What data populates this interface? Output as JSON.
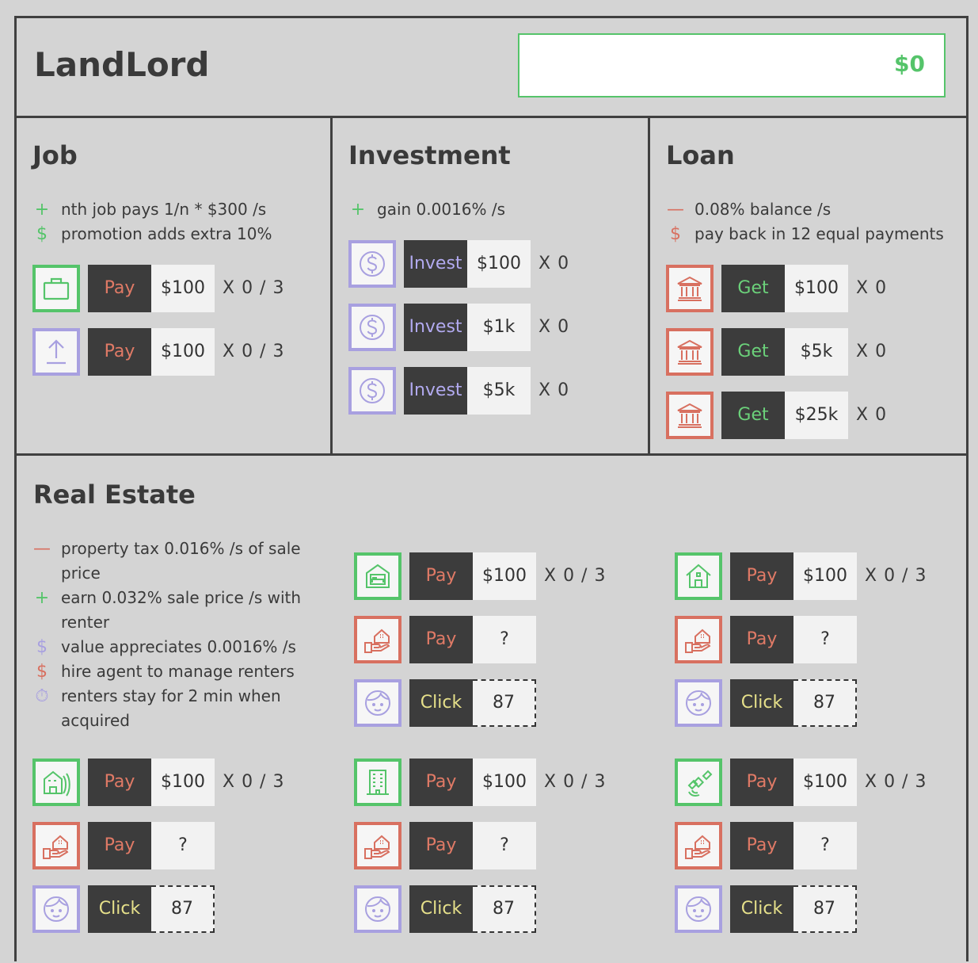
{
  "header": {
    "title": "LandLord",
    "balance": "$0"
  },
  "job": {
    "title": "Job",
    "rules": [
      {
        "symbol": "+",
        "text": "nth job pays 1/n * $300 /s"
      },
      {
        "symbol": "$",
        "text": "promotion adds extra 10%"
      }
    ],
    "rows": [
      {
        "icon": "briefcase-icon",
        "button": "Pay",
        "value": "$100",
        "count": "X 0 / 3"
      },
      {
        "icon": "upload-arrow-icon",
        "button": "Pay",
        "value": "$100",
        "count": "X 0 / 3"
      }
    ]
  },
  "investment": {
    "title": "Investment",
    "rules": [
      {
        "symbol": "+",
        "text": "gain 0.0016% /s"
      }
    ],
    "rows": [
      {
        "icon": "dollar-coin-icon",
        "button": "Invest",
        "value": "$100",
        "count": "X 0"
      },
      {
        "icon": "dollar-coin-icon",
        "button": "Invest",
        "value": "$1k",
        "count": "X 0"
      },
      {
        "icon": "dollar-coin-icon",
        "button": "Invest",
        "value": "$5k",
        "count": "X 0"
      }
    ]
  },
  "loan": {
    "title": "Loan",
    "rules": [
      {
        "symbol": "—",
        "text": "0.08% balance /s"
      },
      {
        "symbol": "$",
        "text": "pay back in 12 equal payments"
      }
    ],
    "rows": [
      {
        "icon": "bank-icon",
        "button": "Get",
        "value": "$100",
        "count": "X 0"
      },
      {
        "icon": "bank-icon",
        "button": "Get",
        "value": "$5k",
        "count": "X 0"
      },
      {
        "icon": "bank-icon",
        "button": "Get",
        "value": "$25k",
        "count": "X 0"
      }
    ]
  },
  "real_estate": {
    "title": "Real Estate",
    "rules": [
      {
        "symbol": "—",
        "line1": "property tax 0.016% /s of sale",
        "line2": "price"
      },
      {
        "symbol": "+",
        "line1": "earn 0.032% sale price /s with",
        "line2": "renter"
      },
      {
        "symbol": "$",
        "line1": "value appreciates 0.0016% /s"
      },
      {
        "symbol": "$",
        "line1": "hire agent to manage renters"
      },
      {
        "symbol": "⏱",
        "line1": "renters stay for 2 min when",
        "line2": "acquired"
      }
    ],
    "properties": [
      {
        "icon": "hotel-room-icon",
        "buy": "Pay",
        "price": "$100",
        "count": "X 0 / 3",
        "agent_button": "Pay",
        "agent_value": "?",
        "renter_button": "Click",
        "renter_value": "87"
      },
      {
        "icon": "house-icon",
        "buy": "Pay",
        "price": "$100",
        "count": "X 0 / 3",
        "agent_button": "Pay",
        "agent_value": "?",
        "renter_button": "Click",
        "renter_value": "87"
      },
      {
        "icon": "apartment-icon",
        "buy": "Pay",
        "price": "$100",
        "count": "X 0 / 3",
        "agent_button": "Pay",
        "agent_value": "?",
        "renter_button": "Click",
        "renter_value": "87"
      },
      {
        "icon": "office-building-icon",
        "buy": "Pay",
        "price": "$100",
        "count": "X 0 / 3",
        "agent_button": "Pay",
        "agent_value": "?",
        "renter_button": "Click",
        "renter_value": "87"
      },
      {
        "icon": "satellite-icon",
        "buy": "Pay",
        "price": "$100",
        "count": "X 0 / 3",
        "agent_button": "Pay",
        "agent_value": "?",
        "renter_button": "Click",
        "renter_value": "87"
      }
    ]
  },
  "colors": {
    "green": "#55c46a",
    "red": "#d87060",
    "purple": "#a8a0e0",
    "dark": "#3c3c3c",
    "background": "#d4d4d4"
  }
}
